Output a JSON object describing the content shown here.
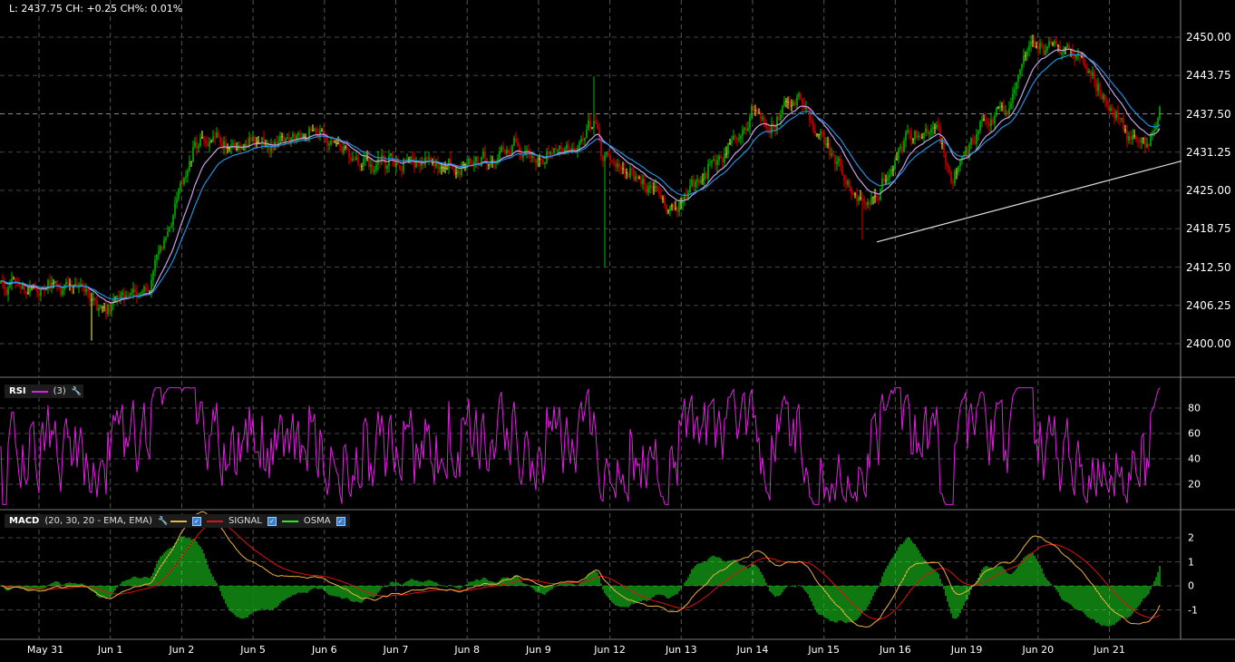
{
  "header": {
    "text": "L: 2437.75 CH: +0.25 CH%: 0.01%"
  },
  "colors": {
    "up": "#00c000",
    "down": "#e00000",
    "doji": "#ffff40",
    "ma_fast": "#c8a0e8",
    "ma_slow": "#2090e0",
    "rsi": "#e020e0",
    "macd": "#f0b040",
    "signal": "#e01010",
    "osma": "#20f020",
    "trendline": "#e0e0e0"
  },
  "rsi_legend": {
    "name": "RSI",
    "params": "(3)"
  },
  "macd_legend": {
    "name": "MACD",
    "params": "(20, 30, 20 - EMA, EMA)",
    "signal": "SIGNAL",
    "osma": "OSMA"
  },
  "chart_data": {
    "type": "candlestick",
    "x_ticks": [
      "May 31",
      "Jun 1",
      "Jun 2",
      "Jun 5",
      "Jun 6",
      "Jun 7",
      "Jun 8",
      "Jun 9",
      "Jun 12",
      "Jun 13",
      "Jun 14",
      "Jun 15",
      "Jun 16",
      "Jun 19",
      "Jun 20",
      "Jun 21"
    ],
    "price_axis": {
      "ticks": [
        "2450.00",
        "2443.75",
        "2437.50",
        "2431.25",
        "2425.00",
        "2418.75",
        "2412.50",
        "2406.25",
        "2400.00"
      ],
      "ylim": [
        2396,
        2452
      ]
    },
    "rsi_axis": {
      "ticks": [
        "80",
        "60",
        "40",
        "20"
      ],
      "ylim": [
        0,
        100
      ],
      "period": 3
    },
    "macd_axis": {
      "ticks": [
        "2",
        "1",
        "0",
        "-1"
      ],
      "ylim": [
        -2.2,
        2.8
      ],
      "fast": 20,
      "slow": 30,
      "signal": 20
    },
    "bar_count": 640,
    "price_path": [
      [
        0,
        2409.8
      ],
      [
        20,
        2409
      ],
      [
        47,
        2409.5
      ],
      [
        55,
        2406.5
      ],
      [
        82,
        2409.5
      ],
      [
        92,
        2419
      ],
      [
        107,
        2432.4
      ],
      [
        125,
        2431.7
      ],
      [
        137,
        2434
      ],
      [
        150,
        2432.4
      ],
      [
        175,
        2434.6
      ],
      [
        200,
        2429.4
      ],
      [
        250,
        2428.7
      ],
      [
        280,
        2431.7
      ],
      [
        300,
        2430
      ],
      [
        320,
        2432.4
      ],
      [
        327,
        2436.8
      ],
      [
        332,
        2431
      ],
      [
        360,
        2424.3
      ],
      [
        370,
        2422
      ],
      [
        390,
        2428.7
      ],
      [
        415,
        2437.6
      ],
      [
        425,
        2436
      ],
      [
        440,
        2439.8
      ],
      [
        455,
        2432.4
      ],
      [
        475,
        2422.8
      ],
      [
        485,
        2425
      ],
      [
        500,
        2434.6
      ],
      [
        517,
        2433.9
      ],
      [
        525,
        2427.2
      ],
      [
        540,
        2435.4
      ],
      [
        555,
        2438.3
      ],
      [
        565,
        2447.2
      ],
      [
        580,
        2449.4
      ],
      [
        592,
        2447.9
      ],
      [
        605,
        2441.3
      ],
      [
        620,
        2433.9
      ],
      [
        631,
        2432.4
      ],
      [
        639,
        2438
      ]
    ],
    "spikes": [
      {
        "bar": 327,
        "high": 2443.6
      },
      {
        "bar": 333,
        "low": 2412.5
      },
      {
        "bar": 50,
        "low": 2400.5
      },
      {
        "bar": 475,
        "low": 2417
      }
    ],
    "trendline": {
      "from": [
        483,
        2416.6
      ],
      "to": [
        651,
        2429.8
      ]
    },
    "last_price": 2437.5
  }
}
